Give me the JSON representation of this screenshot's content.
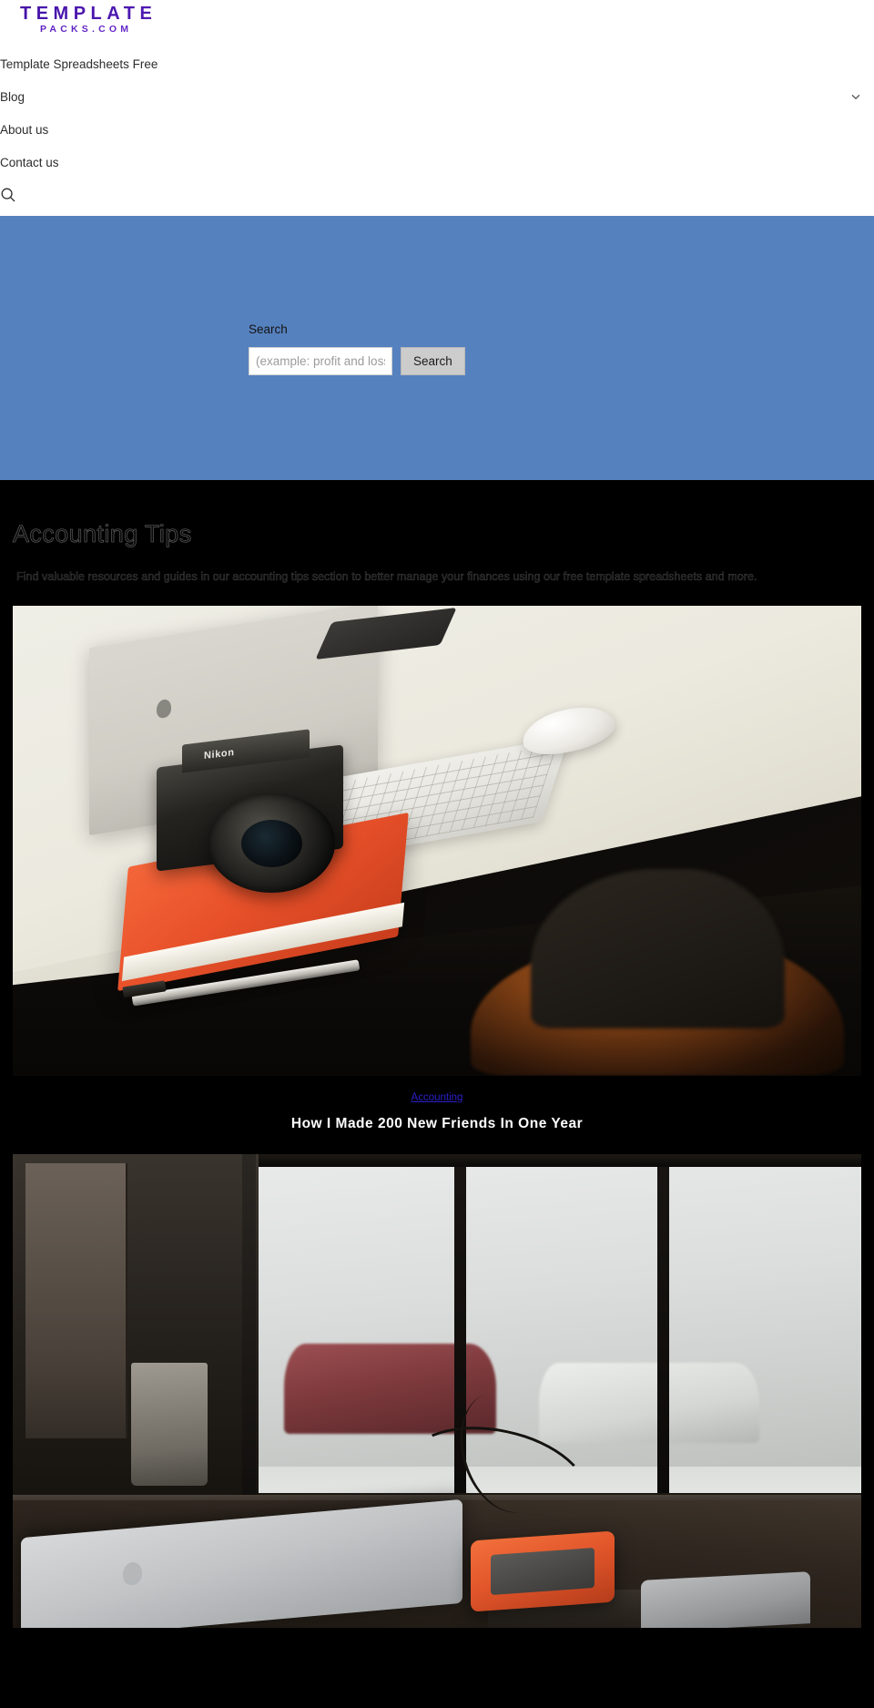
{
  "site": {
    "logo_main": "TEMPLATE",
    "logo_sub": "PACKS.COM",
    "logo_color_start": "#4514a8",
    "logo_color_end": "#9b6be0"
  },
  "nav": {
    "items": [
      {
        "label": "Template Spreadsheets Free",
        "has_submenu": false
      },
      {
        "label": "Blog",
        "has_submenu": true
      },
      {
        "label": "About us",
        "has_submenu": false
      },
      {
        "label": "Contact us",
        "has_submenu": false
      }
    ],
    "search_toggle_icon": "search-icon",
    "chevron_icon": "chevron-down-icon"
  },
  "hero": {
    "background_color": "#5681bf",
    "search_label": "Search",
    "search_value": "",
    "search_placeholder": "(example: profit and loss statement)",
    "search_button_label": "Search",
    "search_button_color": "#cccccc"
  },
  "archive": {
    "background_color": "#000000",
    "title": "Accounting Tips",
    "description": "Find valuable resources and guides in our accounting tips section to better manage your finances using our free template spreadsheets and more.",
    "posts": [
      {
        "image_alt": "Nikon camera on an orange notebook beside an iMac, keyboard and mouse on a white desk",
        "category": "Accounting",
        "category_color": "#2b20c9",
        "title": "How I Made 200 New Friends In One Year"
      },
      {
        "image_alt": "MacBook, orange LaCie rugged drive and cable on a dark desk by a snowy window",
        "category": "",
        "category_color": "#2b20c9",
        "title": ""
      }
    ]
  }
}
